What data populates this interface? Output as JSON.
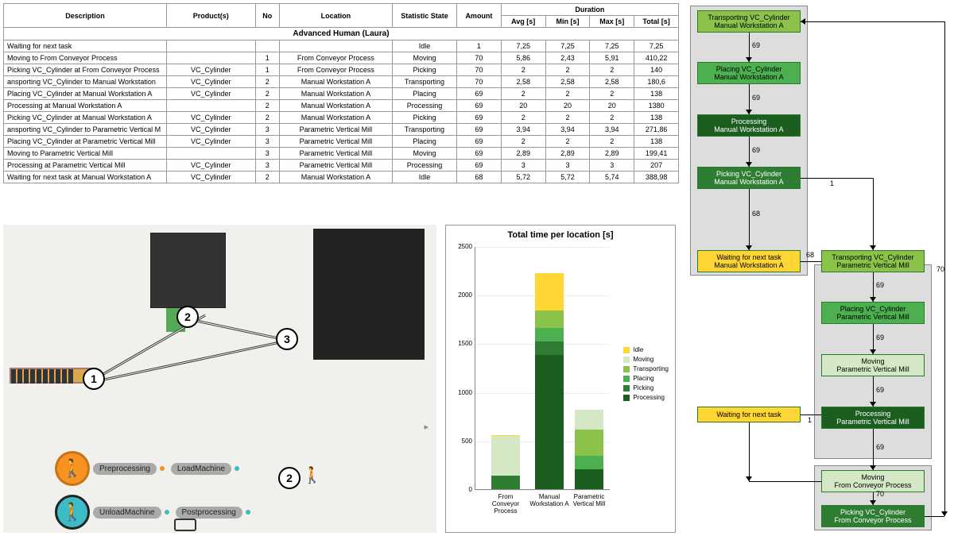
{
  "table": {
    "headers": {
      "description": "Description",
      "products": "Product(s)",
      "no": "No",
      "location": "Location",
      "state": "Statistic State",
      "amount": "Amount",
      "duration": "Duration",
      "avg": "Avg [s]",
      "min": "Min [s]",
      "max": "Max [s]",
      "total": "Total [s]"
    },
    "group_title": "Advanced Human (Laura)",
    "rows": [
      {
        "desc": "Waiting for next task",
        "prod": "",
        "no": "",
        "loc": "",
        "state": "Idle",
        "amt": "1",
        "avg": "7,25",
        "min": "7,25",
        "max": "7,25",
        "total": "7,25"
      },
      {
        "desc": "Moving to From Conveyor Process",
        "prod": "",
        "no": "1",
        "loc": "From Conveyor Process",
        "state": "Moving",
        "amt": "70",
        "avg": "5,86",
        "min": "2,43",
        "max": "5,91",
        "total": "410,22"
      },
      {
        "desc": "Picking VC_Cylinder at From Conveyor Process",
        "prod": "VC_Cylinder",
        "no": "1",
        "loc": "From Conveyor Process",
        "state": "Picking",
        "amt": "70",
        "avg": "2",
        "min": "2",
        "max": "2",
        "total": "140"
      },
      {
        "desc": "ansporting VC_Cylinder to Manual Workstation",
        "prod": "VC_Cylinder",
        "no": "2",
        "loc": "Manual Workstation A",
        "state": "Transporting",
        "amt": "70",
        "avg": "2,58",
        "min": "2,58",
        "max": "2,58",
        "total": "180,6"
      },
      {
        "desc": "Placing VC_Cylinder at Manual Workstation A",
        "prod": "VC_Cylinder",
        "no": "2",
        "loc": "Manual Workstation A",
        "state": "Placing",
        "amt": "69",
        "avg": "2",
        "min": "2",
        "max": "2",
        "total": "138"
      },
      {
        "desc": "Processing  at Manual Workstation A",
        "prod": "",
        "no": "2",
        "loc": "Manual Workstation A",
        "state": "Processing",
        "amt": "69",
        "avg": "20",
        "min": "20",
        "max": "20",
        "total": "1380"
      },
      {
        "desc": "Picking VC_Cylinder at Manual Workstation A",
        "prod": "VC_Cylinder",
        "no": "2",
        "loc": "Manual Workstation A",
        "state": "Picking",
        "amt": "69",
        "avg": "2",
        "min": "2",
        "max": "2",
        "total": "138"
      },
      {
        "desc": "ansporting VC_Cylinder to Parametric Vertical M",
        "prod": "VC_Cylinder",
        "no": "3",
        "loc": "Parametric Vertical Mill",
        "state": "Transporting",
        "amt": "69",
        "avg": "3,94",
        "min": "3,94",
        "max": "3,94",
        "total": "271,86"
      },
      {
        "desc": "Placing VC_Cylinder at Parametric Vertical Mill",
        "prod": "VC_Cylinder",
        "no": "3",
        "loc": "Parametric Vertical Mill",
        "state": "Placing",
        "amt": "69",
        "avg": "2",
        "min": "2",
        "max": "2",
        "total": "138"
      },
      {
        "desc": "Moving to Parametric Vertical Mill",
        "prod": "",
        "no": "3",
        "loc": "Parametric Vertical Mill",
        "state": "Moving",
        "amt": "69",
        "avg": "2,89",
        "min": "2,89",
        "max": "2,89",
        "total": "199,41"
      },
      {
        "desc": "Processing  at Parametric Vertical Mill",
        "prod": "VC_Cylinder",
        "no": "3",
        "loc": "Parametric Vertical Mill",
        "state": "Processing",
        "amt": "69",
        "avg": "3",
        "min": "3",
        "max": "3",
        "total": "207"
      },
      {
        "desc": "Waiting for next task at Manual Workstation A",
        "prod": "VC_Cylinder",
        "no": "2",
        "loc": "Manual Workstation A",
        "state": "Idle",
        "amt": "68",
        "avg": "5,72",
        "min": "5,72",
        "max": "5,74",
        "total": "388,98"
      }
    ]
  },
  "sim": {
    "markers": [
      "1",
      "2",
      "3",
      "2"
    ],
    "pills": {
      "preprocessing": "Preprocessing",
      "loadmachine": "LoadMachine",
      "unloadmachine": "UnloadMachine",
      "postprocessing": "Postprocessing"
    }
  },
  "chart_data": {
    "type": "bar",
    "title": "Total time per location [s]",
    "ylim": [
      0,
      2500
    ],
    "yticks": [
      0,
      500,
      1000,
      1500,
      2000,
      2500
    ],
    "categories": [
      "From Conveyor Process",
      "Manual Workstation A",
      "Parametric Vertical Mill"
    ],
    "series": [
      {
        "name": "Idle",
        "color": "#ffd633",
        "values": [
          7,
          389,
          0
        ]
      },
      {
        "name": "Moving",
        "color": "#d5e8c5",
        "values": [
          410,
          0,
          199
        ]
      },
      {
        "name": "Transporting",
        "color": "#8bc34a",
        "values": [
          0,
          181,
          272
        ]
      },
      {
        "name": "Placing",
        "color": "#4caf50",
        "values": [
          0,
          138,
          138
        ]
      },
      {
        "name": "Picking",
        "color": "#2e7d32",
        "values": [
          140,
          138,
          0
        ]
      },
      {
        "name": "Processing",
        "color": "#1b5e20",
        "values": [
          0,
          1380,
          207
        ]
      }
    ]
  },
  "flow": {
    "nodes": [
      {
        "id": "n1",
        "l1": "Transporting VC_Cylinder",
        "l2": "Manual Workstation A",
        "cls": "c-transporting"
      },
      {
        "id": "n2",
        "l1": "Placing VC_Cylinder",
        "l2": "Manual Workstation A",
        "cls": "c-placing"
      },
      {
        "id": "n3",
        "l1": "Processing",
        "l2": "Manual Workstation A",
        "cls": "c-processing",
        "fg": "#fff"
      },
      {
        "id": "n4",
        "l1": "Picking VC_Cylinder",
        "l2": "Manual Workstation A",
        "cls": "c-picking",
        "fg": "#fff"
      },
      {
        "id": "n5",
        "l1": "Waiting for next task",
        "l2": "Manual Workstation A",
        "cls": "c-idle"
      },
      {
        "id": "n6",
        "l1": "Transporting VC_Cylinder",
        "l2": "Parametric Vertical Mill",
        "cls": "c-transporting"
      },
      {
        "id": "n7",
        "l1": "Placing VC_Cylinder",
        "l2": "Parametric Vertical Mill",
        "cls": "c-placing"
      },
      {
        "id": "n8",
        "l1": "Moving",
        "l2": "Parametric Vertical Mill",
        "cls": "c-moving"
      },
      {
        "id": "n9",
        "l1": "Processing",
        "l2": "Parametric Vertical Mill",
        "cls": "c-processing",
        "fg": "#fff"
      },
      {
        "id": "n10",
        "l1": "Waiting for next task",
        "l2": "",
        "cls": "c-idle"
      },
      {
        "id": "n11",
        "l1": "Moving",
        "l2": "From Conveyor Process",
        "cls": "c-moving"
      },
      {
        "id": "n12",
        "l1": "Picking VC_Cylinder",
        "l2": "From Conveyor Process",
        "cls": "c-picking",
        "fg": "#fff"
      }
    ],
    "edge_labels": [
      "69",
      "69",
      "69",
      "68",
      "1",
      "68",
      "69",
      "69",
      "69",
      "69",
      "1",
      "70",
      "70"
    ]
  }
}
